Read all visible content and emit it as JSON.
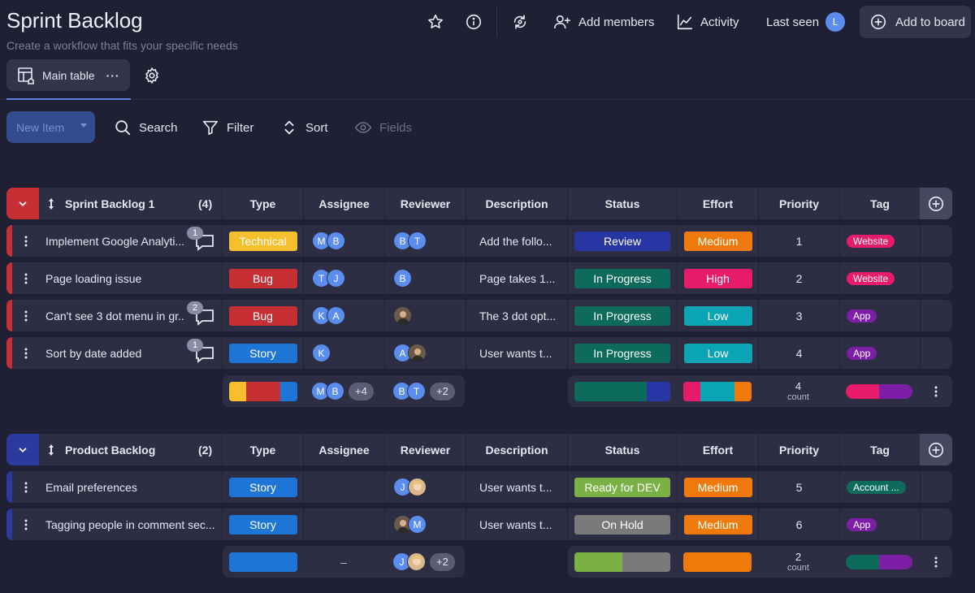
{
  "header": {
    "title": "Sprint Backlog",
    "subtitle": "Create a workflow that fits your specific needs",
    "add_members": "Add members",
    "activity": "Activity",
    "last_seen": "Last seen",
    "last_seen_avatar": "L",
    "add_to_board": "Add to board"
  },
  "tabs": {
    "main_table": "Main table",
    "more": "···"
  },
  "toolbar": {
    "new_item": "New Item",
    "search": "Search",
    "filter": "Filter",
    "sort": "Sort",
    "fields": "Fields"
  },
  "columns": [
    "Type",
    "Assignee",
    "Reviewer",
    "Description",
    "Status",
    "Effort",
    "Priority",
    "Tag"
  ],
  "colors": {
    "technical": "#f5c02c",
    "bug": "#c62f34",
    "story": "#1d76d6",
    "review": "#2836a4",
    "in_progress": "#0c6b5b",
    "ready_for_dev": "#7bb144",
    "on_hold": "#7a7a7a",
    "medium": "#ef7a0b",
    "high": "#e61b6a",
    "low": "#0ba4b4",
    "website": "#e61b6a",
    "app": "#7c1fa6",
    "account": "#0c6b5b",
    "group1": "#c62f34",
    "group2": "#2c3a9e"
  },
  "group1": {
    "name": "Sprint Backlog 1",
    "count": "(4)",
    "items": [
      {
        "name": "Implement Google Analyti...",
        "comments": "1",
        "type": "Technical",
        "assignee": [
          "M",
          "B"
        ],
        "reviewer": [
          "B",
          "T"
        ],
        "description": "Add the follo...",
        "status": "Review",
        "effort": "Medium",
        "priority": "1",
        "tag": "Website"
      },
      {
        "name": "Page loading issue",
        "comments": "",
        "type": "Bug",
        "assignee": [
          "T",
          "J"
        ],
        "reviewer": [
          "B"
        ],
        "description": "Page takes 1...",
        "status": "In Progress",
        "effort": "High",
        "priority": "2",
        "tag": "Website"
      },
      {
        "name": "Can't see 3 dot menu in gr...",
        "comments": "2",
        "type": "Bug",
        "assignee": [
          "K",
          "A"
        ],
        "reviewer": [
          "photo"
        ],
        "description": "The 3 dot opt...",
        "status": "In Progress",
        "effort": "Low",
        "priority": "3",
        "tag": "App"
      },
      {
        "name": "Sort by date added",
        "comments": "1",
        "type": "Story",
        "assignee": [
          "K"
        ],
        "reviewer": [
          "A",
          "photo"
        ],
        "description": "User wants t...",
        "status": "In Progress",
        "effort": "Low",
        "priority": "4",
        "tag": "App"
      }
    ],
    "summary": {
      "assignee_more": "+4",
      "reviewer_more": "+2",
      "priority_count": "4",
      "count_label": "count"
    }
  },
  "group2": {
    "name": "Product Backlog",
    "count": "(2)",
    "items": [
      {
        "name": "Email preferences",
        "type": "Story",
        "description": "User wants t...",
        "status": "Ready for DEV",
        "effort": "Medium",
        "priority": "5",
        "tag": "Account ..."
      },
      {
        "name": "Tagging people in comment sec...",
        "type": "Story",
        "description": "User wants t...",
        "status": "On Hold",
        "effort": "Medium",
        "priority": "6",
        "tag": "App"
      }
    ],
    "summary": {
      "assignee_empty": "–",
      "reviewer_more": "+2",
      "priority_count": "2",
      "count_label": "count"
    }
  }
}
